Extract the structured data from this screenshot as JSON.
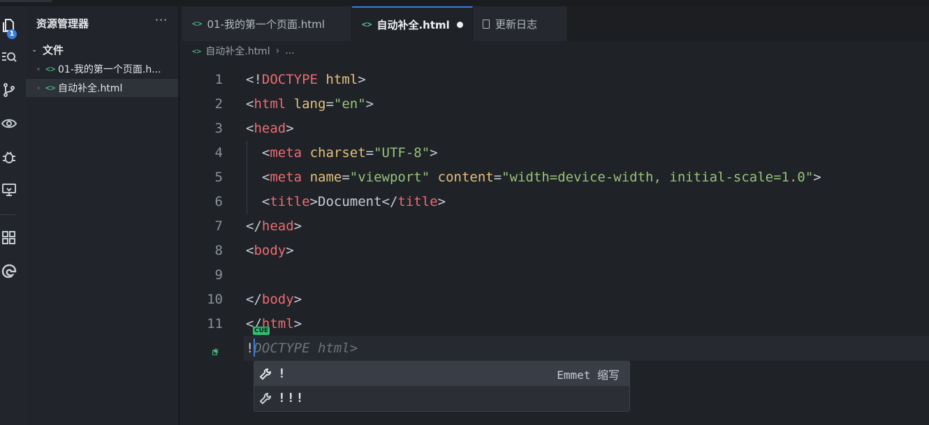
{
  "explorer": {
    "title": "资源管理器",
    "more": "···",
    "folder": "文件",
    "files": [
      {
        "name": "01-我的第一个页面.html",
        "display": "01-我的第一个页面.h..."
      },
      {
        "name": "自动补全.html",
        "display": "自动补全.html"
      }
    ]
  },
  "activity": {
    "badge": "1"
  },
  "tabs": [
    {
      "label": "01-我的第一个页面.html",
      "icon": "code-icon"
    },
    {
      "label": "自动补全.html",
      "icon": "code-icon",
      "modified": true
    },
    {
      "label": "更新日志",
      "icon": "document-icon"
    }
  ],
  "breadcrumb": {
    "file": "自动补全.html",
    "rest": "..."
  },
  "editor": {
    "line_numbers": [
      "1",
      "2",
      "3",
      "4",
      "5",
      "6",
      "7",
      "8",
      "9",
      "10",
      "11"
    ],
    "typed": "!",
    "ghost": "DOCTYPE html>",
    "cue": "CUE"
  },
  "suggest": {
    "items": [
      {
        "label": "!",
        "detail": "Emmet 缩写"
      },
      {
        "label": "!!!",
        "detail": ""
      }
    ]
  },
  "colors": {
    "accent": "#3b7ddd",
    "tag": "#ef6b73",
    "attr": "#e5c07b",
    "string": "#98c379",
    "file_icon": "#4ec98a"
  }
}
